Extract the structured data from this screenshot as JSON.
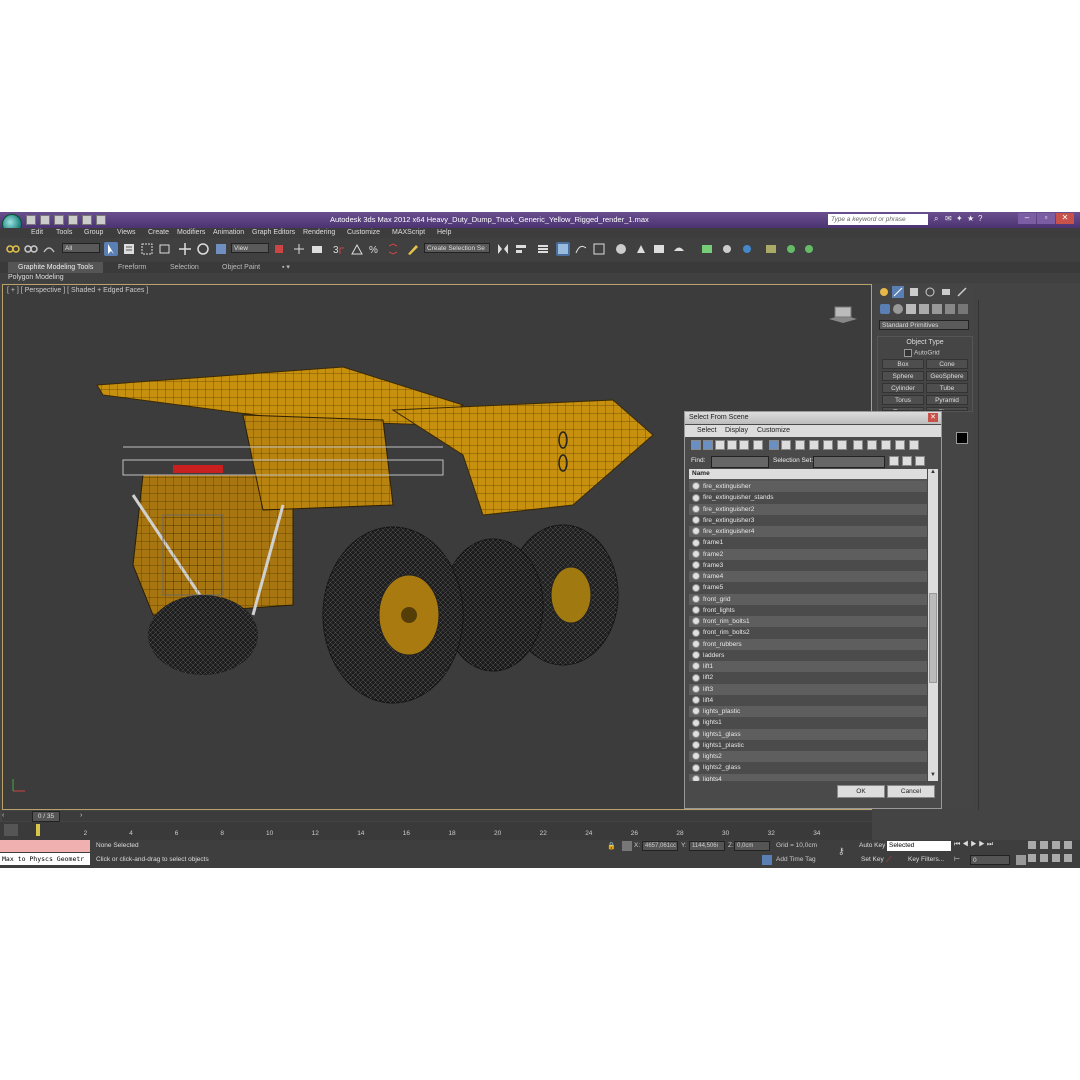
{
  "app": {
    "title": "Autodesk 3ds Max  2012 x64      Heavy_Duty_Dump_Truck_Generic_Yellow_Rigged_render_1.max",
    "search_placeholder": "Type a keyword or phrase"
  },
  "menu": [
    "Edit",
    "Tools",
    "Group",
    "Views",
    "Create",
    "Modifiers",
    "Animation",
    "Graph Editors",
    "Rendering",
    "Customize",
    "MAXScript",
    "Help"
  ],
  "toolbar": {
    "selection_filter": "All",
    "ref_coord": "View",
    "named_selection": "Create Selection Se"
  },
  "ribbon": {
    "tabs": [
      "Graphite Modeling Tools",
      "Freeform",
      "Selection",
      "Object Paint"
    ],
    "panel_label": "Polygon Modeling"
  },
  "viewport": {
    "label": "[ + ] [ Perspective ] [ Shaded + Edged Faces ]"
  },
  "command_panel": {
    "category": "Standard Primitives",
    "object_type_title": "Object Type",
    "autogrid_label": "AutoGrid",
    "primitives": [
      "Box",
      "Cone",
      "Sphere",
      "GeoSphere",
      "Cylinder",
      "Tube",
      "Torus",
      "Pyramid",
      "Teapot",
      "Plane"
    ]
  },
  "dialog": {
    "title": "Select From Scene",
    "menu": [
      "Select",
      "Display",
      "Customize"
    ],
    "find_label": "Find:",
    "selection_set_label": "Selection Set:",
    "column_header": "Name",
    "items": [
      "fire_extinguisher",
      "fire_extinguisher_stands",
      "fire_extinguisher2",
      "fire_extinguisher3",
      "fire_extinguisher4",
      "frame1",
      "frame2",
      "frame3",
      "frame4",
      "frame5",
      "front_grid",
      "front_lights",
      "front_rim_bolts1",
      "front_rim_bolts2",
      "front_rubbers",
      "ladders",
      "lift1",
      "lift2",
      "lift3",
      "lift4",
      "lights_plastic",
      "lights1",
      "lights1_glass",
      "lights1_plastic",
      "lights2",
      "lights2_glass",
      "lights4"
    ],
    "ok": "OK",
    "cancel": "Cancel"
  },
  "timeline": {
    "slider_label": "0 / 35",
    "ticks": [
      "0",
      "2",
      "4",
      "6",
      "8",
      "10",
      "12",
      "14",
      "16",
      "18",
      "20",
      "22",
      "24",
      "26",
      "28",
      "30",
      "32",
      "34"
    ]
  },
  "status": {
    "maxscript": "Max to Physcs Geometr",
    "selection": "None Selected",
    "prompt": "Click or click-and-drag to select objects",
    "x_label": "X:",
    "x_value": "4657,061cc",
    "y_label": "Y:",
    "y_value": "1144,506i",
    "z_label": "Z:",
    "z_value": "0,0cm",
    "grid": "Grid = 10,0cm",
    "add_time_tag": "Add Time Tag",
    "auto_key": "Auto Key",
    "set_key": "Set Key",
    "key_mode": "Selected",
    "key_filters": "Key Filters...",
    "frame_value": "0"
  }
}
